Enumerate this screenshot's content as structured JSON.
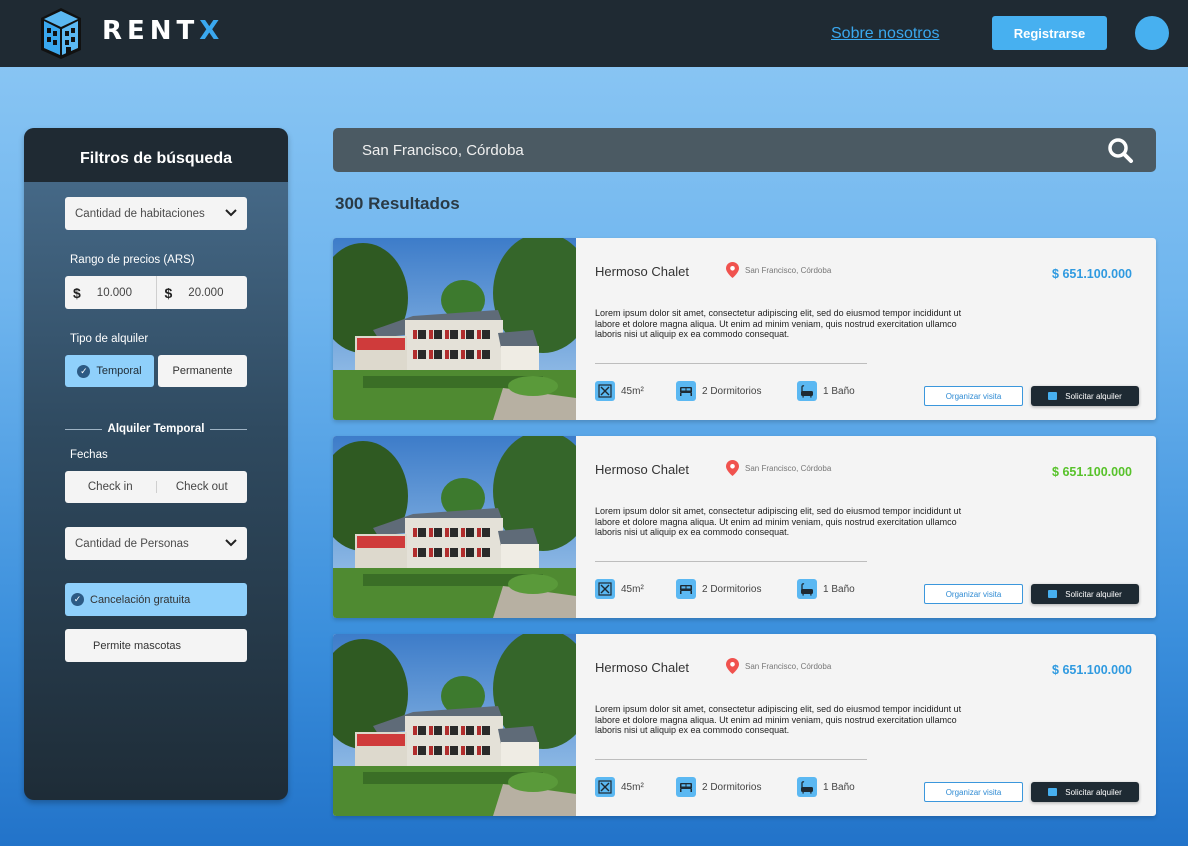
{
  "header": {
    "logo_text": "RENT",
    "logo_accent": "X",
    "nav_link": "Sobre nosotros",
    "register_label": "Registrarse"
  },
  "sidebar": {
    "title": "Filtros de búsqueda",
    "rooms_select": "Cantidad de habitaciones",
    "price_label": "Rango de precios (ARS)",
    "price_symbol": "$",
    "price_min": "10.000",
    "price_max": "20.000",
    "rental_type_label": "Tipo de alquiler",
    "rental_type_options": [
      "Temporal",
      "Permanente"
    ],
    "temporal_section": "Alquiler Temporal",
    "dates_label": "Fechas",
    "check_in": "Check in",
    "check_out": "Check out",
    "people_select": "Cantidad de Personas",
    "free_cancel": "Cancelación gratuita",
    "pets": "Permite mascotas"
  },
  "search": {
    "value": "San Francisco, Córdoba"
  },
  "results_count": "300 Resultados",
  "listings": [
    {
      "title": "Hermoso Chalet",
      "location": "San Francisco, Córdoba",
      "price": "$ 651.100.000",
      "price_color": "#2f9ae0",
      "description": "Lorem ipsum dolor sit amet, consectetur adipiscing elit, sed do eiusmod tempor incididunt ut labore et dolore magna aliqua. Ut enim ad minim veniam, quis nostrud exercitation ullamco laboris nisi ut aliquip ex ea commodo consequat.",
      "area": "45m²",
      "bedrooms": "2 Dormitorios",
      "baths": "1 Baño",
      "visit_label": "Organizar visita",
      "rent_label": "Solicitar alquiler"
    },
    {
      "title": "Hermoso Chalet",
      "location": "San Francisco, Córdoba",
      "price": "$ 651.100.000",
      "price_color": "#57c22a",
      "description": "Lorem ipsum dolor sit amet, consectetur adipiscing elit, sed do eiusmod tempor incididunt ut labore et dolore magna aliqua. Ut enim ad minim veniam, quis nostrud exercitation ullamco laboris nisi ut aliquip ex ea commodo consequat.",
      "area": "45m²",
      "bedrooms": "2 Dormitorios",
      "baths": "1 Baño",
      "visit_label": "Organizar visita",
      "rent_label": "Solicitar alquiler"
    },
    {
      "title": "Hermoso Chalet",
      "location": "San Francisco, Córdoba",
      "price": "$ 651.100.000",
      "price_color": "#2f9ae0",
      "description": "Lorem ipsum dolor sit amet, consectetur adipiscing elit, sed do eiusmod tempor incididunt ut labore et dolore magna aliqua. Ut enim ad minim veniam, quis nostrud exercitation ullamco laboris nisi ut aliquip ex ea commodo consequat.",
      "area": "45m²",
      "bedrooms": "2 Dormitorios",
      "baths": "1 Baño",
      "visit_label": "Organizar visita",
      "rent_label": "Solicitar alquiler"
    }
  ]
}
